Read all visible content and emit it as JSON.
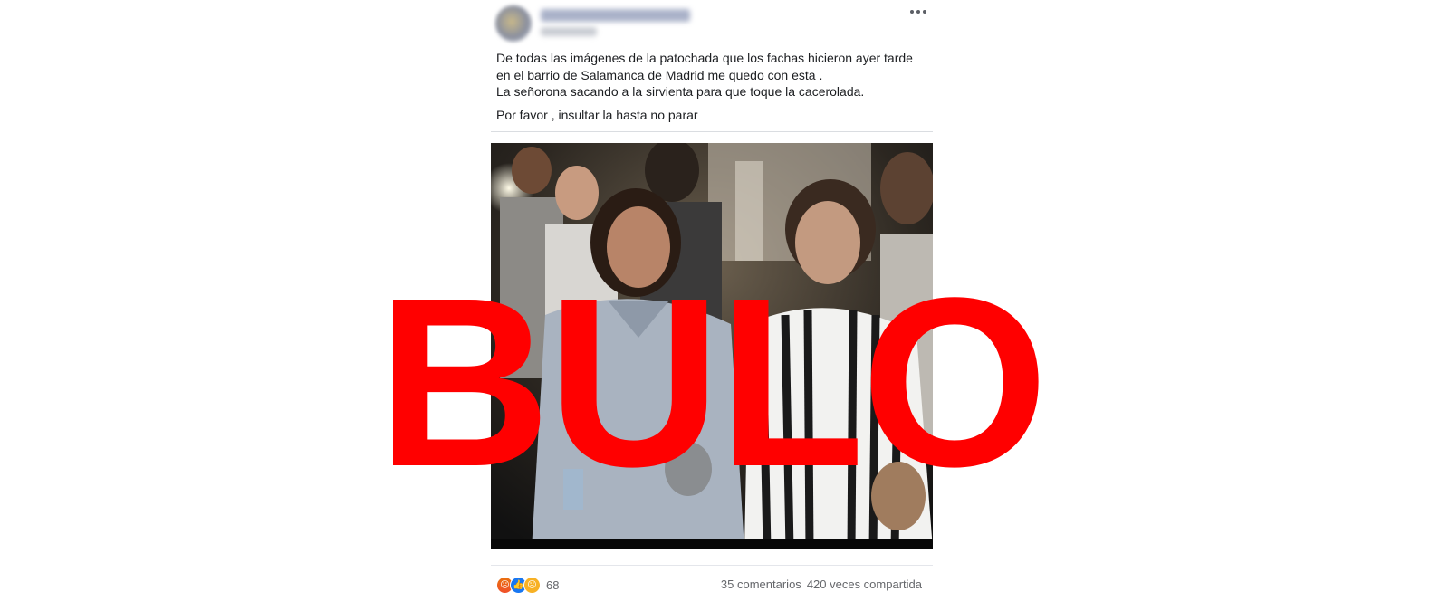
{
  "post": {
    "text_lines": [
      "De todas las imágenes de la patochada que los fachas hicieron ayer tarde",
      "en el barrio de Salamanca de Madrid me quedo con esta .",
      "La señorona sacando a la sirvienta para que toque la cacerolada.",
      "Por favor , insultar la hasta no parar"
    ],
    "author_blurred": true,
    "more_icon": "more-dots-icon"
  },
  "stamp": {
    "text": "BULO",
    "color": "#ff0000"
  },
  "footer": {
    "reaction_icons": [
      "angry-reaction-icon",
      "like-reaction-icon",
      "sad-reaction-icon"
    ],
    "reaction_count": "68",
    "comments": "35 comentarios",
    "shares": "420 veces compartida"
  },
  "colors": {
    "like_blue": "#1877f2",
    "text_secondary": "#65676b"
  }
}
